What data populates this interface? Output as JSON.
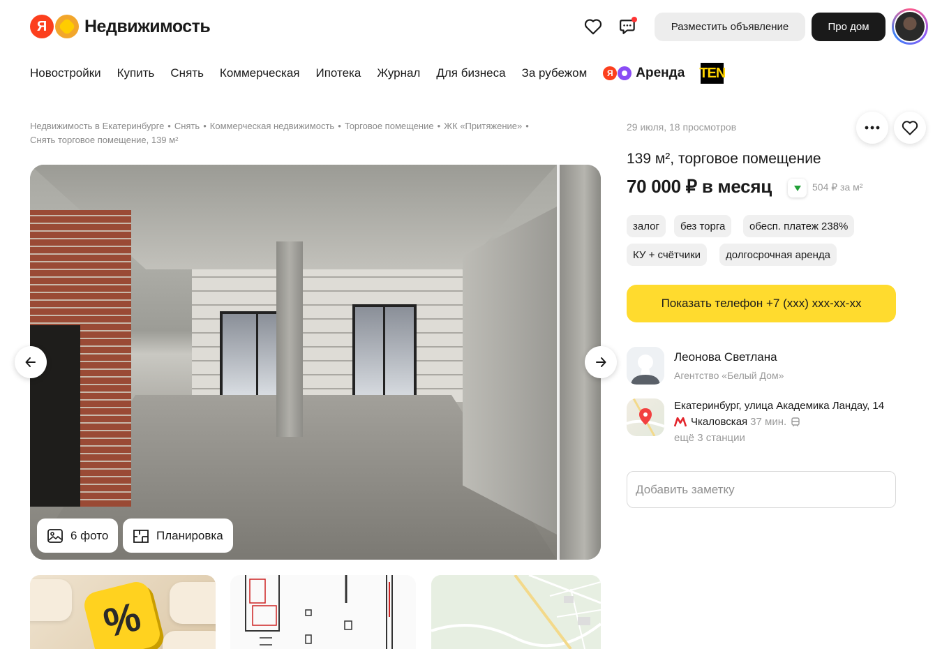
{
  "header": {
    "logo_ya": "Я",
    "logo_text": "Недвижимость",
    "favorites_icon": "heart-icon",
    "chat_icon": "chat-icon",
    "place_ad": "Разместить объявление",
    "pro_dom": "Про дом"
  },
  "nav": {
    "items": [
      "Новостройки",
      "Купить",
      "Снять",
      "Коммерческая",
      "Ипотека",
      "Журнал",
      "Для бизнеса",
      "За рубежом"
    ],
    "arenda_ya": "Я",
    "arenda": "Аренда",
    "ten": "TEN"
  },
  "breadcrumbs": [
    "Недвижимость в Екатеринбурге",
    "Снять",
    "Коммерческая недвижимость",
    "Торговое помещение",
    "ЖК «Притяжение»",
    "Снять торговое помещение, 139 м²"
  ],
  "gallery": {
    "photos_label": "6 фото",
    "plan_label": "Планировка"
  },
  "promo": {
    "symbol": "%"
  },
  "listing": {
    "meta": "29 июля, 18 просмотров",
    "title": "139 м², торговое помещение",
    "price": "70 000 ₽ в месяц",
    "price_per_m2": "504 ₽ за м²",
    "tags_row1": [
      "залог",
      "без торга",
      "обесп. платеж 238%"
    ],
    "tags_row2": [
      "КУ + счётчики",
      "долгосрочная аренда"
    ],
    "phone_button": "Показать телефон +7 (ххх) ххх-хх-хх"
  },
  "seller": {
    "name": "Леонова Светлана",
    "agency": "Агентство «Белый Дом»"
  },
  "location": {
    "address": "Екатеринбург, улица Академика Ландау, 14",
    "metro_station": "Чкаловская",
    "metro_time": "37 мин.",
    "more_stations": "ещё 3 станции"
  },
  "note": {
    "placeholder": "Добавить заметку"
  },
  "colors": {
    "accent_yellow": "#ffdb2e",
    "ya_red": "#fc3f1d",
    "metro_red": "#e3242b",
    "price_down_green": "#21a038"
  }
}
